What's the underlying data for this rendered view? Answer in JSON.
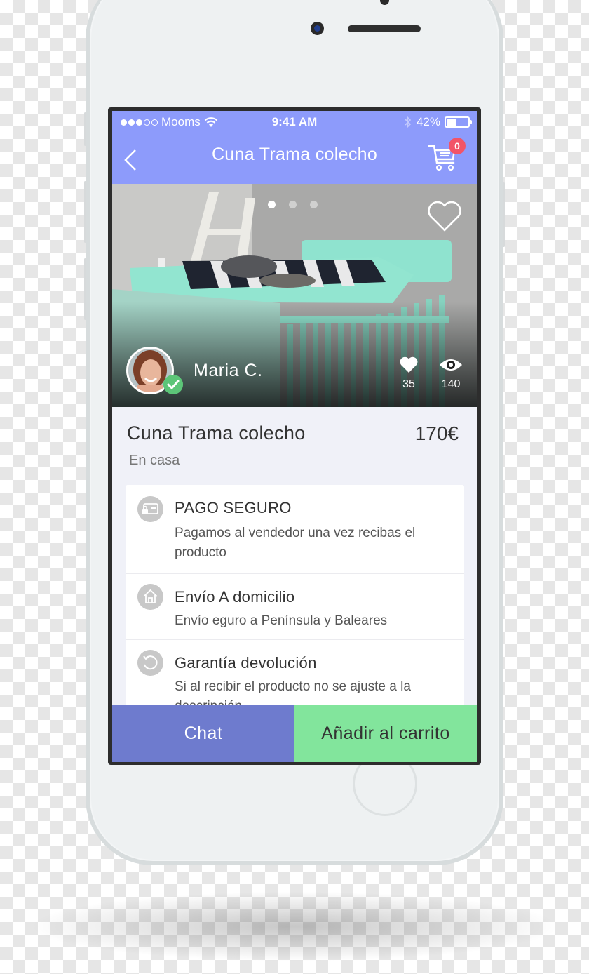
{
  "status_bar": {
    "signal_filled": 3,
    "signal_total": 5,
    "carrier": "Mooms",
    "time": "9:41 AM",
    "battery_percent_label": "42%",
    "battery_level": 0.42
  },
  "header": {
    "title": "Cuna Trama colecho",
    "back_icon": "chevron-left-icon",
    "cart_icon": "shopping-cart-icon",
    "cart_count": "0"
  },
  "gallery": {
    "image_count": 3,
    "active_index": 0,
    "favorite_icon": "heart-outline-icon"
  },
  "seller": {
    "name": "Maria C.",
    "verified": true
  },
  "stats": {
    "likes": "35",
    "views": "140"
  },
  "product": {
    "title": "Cuna Trama colecho",
    "price": "170€",
    "subtitle": "En casa"
  },
  "features": [
    {
      "icon": "secure-payment-icon",
      "title": "PAGO SEGURO",
      "description": "Pagamos al vendedor una vez recibas el producto"
    },
    {
      "icon": "home-icon",
      "title": "Envío A domicilio",
      "description": "Envío eguro a Península y Baleares"
    },
    {
      "icon": "return-icon",
      "title": "Garantía devolución",
      "description": "Si al recibir el producto no se ajuste a la descripción"
    }
  ],
  "actions": {
    "chat_label": "Chat",
    "add_to_cart_label": "Añadir al carrito"
  },
  "colors": {
    "header": "#8d9bfb",
    "chat_button": "#6e7bce",
    "cart_button": "#82e59c",
    "badge": "#f25468",
    "verified": "#5cc578"
  }
}
